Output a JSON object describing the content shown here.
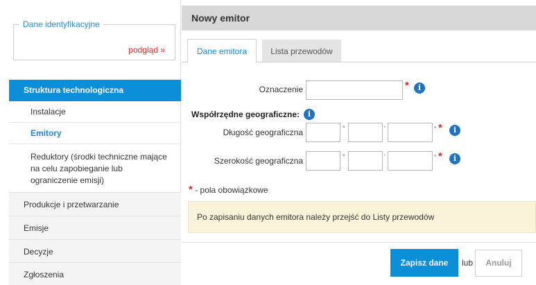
{
  "sidebar": {
    "fieldset_legend": "Dane identyfikacyjne",
    "preview_link": "podgląd »",
    "active_section": "Struktura technologiczna",
    "sub_items": [
      "Instalacje",
      "Emitory",
      "Reduktory (środki techniczne mające na celu zapobieganie lub ograniczenie emisji)"
    ],
    "items": [
      "Produkcje i przetwarzanie",
      "Emisje",
      "Decyzje",
      "Zgłoszenia"
    ]
  },
  "main": {
    "title": "Nowy emitor",
    "tabs": [
      {
        "label": "Dane emitora",
        "active": true
      },
      {
        "label": "Lista przewodów",
        "active": false
      }
    ],
    "form": {
      "oznaczenie_label": "Oznaczenie",
      "oznaczenie_value": "",
      "geo_title": "Współrzędne geograficzne:",
      "longitude_label": "Długość geograficzna",
      "latitude_label": "Szerokość geograficzna",
      "deg_symbol": "°",
      "min_symbol": "'",
      "sec_symbol": "''",
      "required_marker": "*",
      "info_icon_glyph": "i"
    },
    "required_note": "- pola obowiązkowe",
    "notice": "Po zapisaniu danych emitora należy przejść do Listy przewodów",
    "save_label": "Zapisz dane",
    "or_label": "lub",
    "cancel_label": "Anuluj"
  },
  "colors": {
    "accent": "#0a8fd8",
    "link": "#1b87c9",
    "required": "#d0281f",
    "notice_bg": "#f9f3d9",
    "header_bg": "#d7d7d7"
  },
  "icons": {
    "info": "info-icon"
  }
}
